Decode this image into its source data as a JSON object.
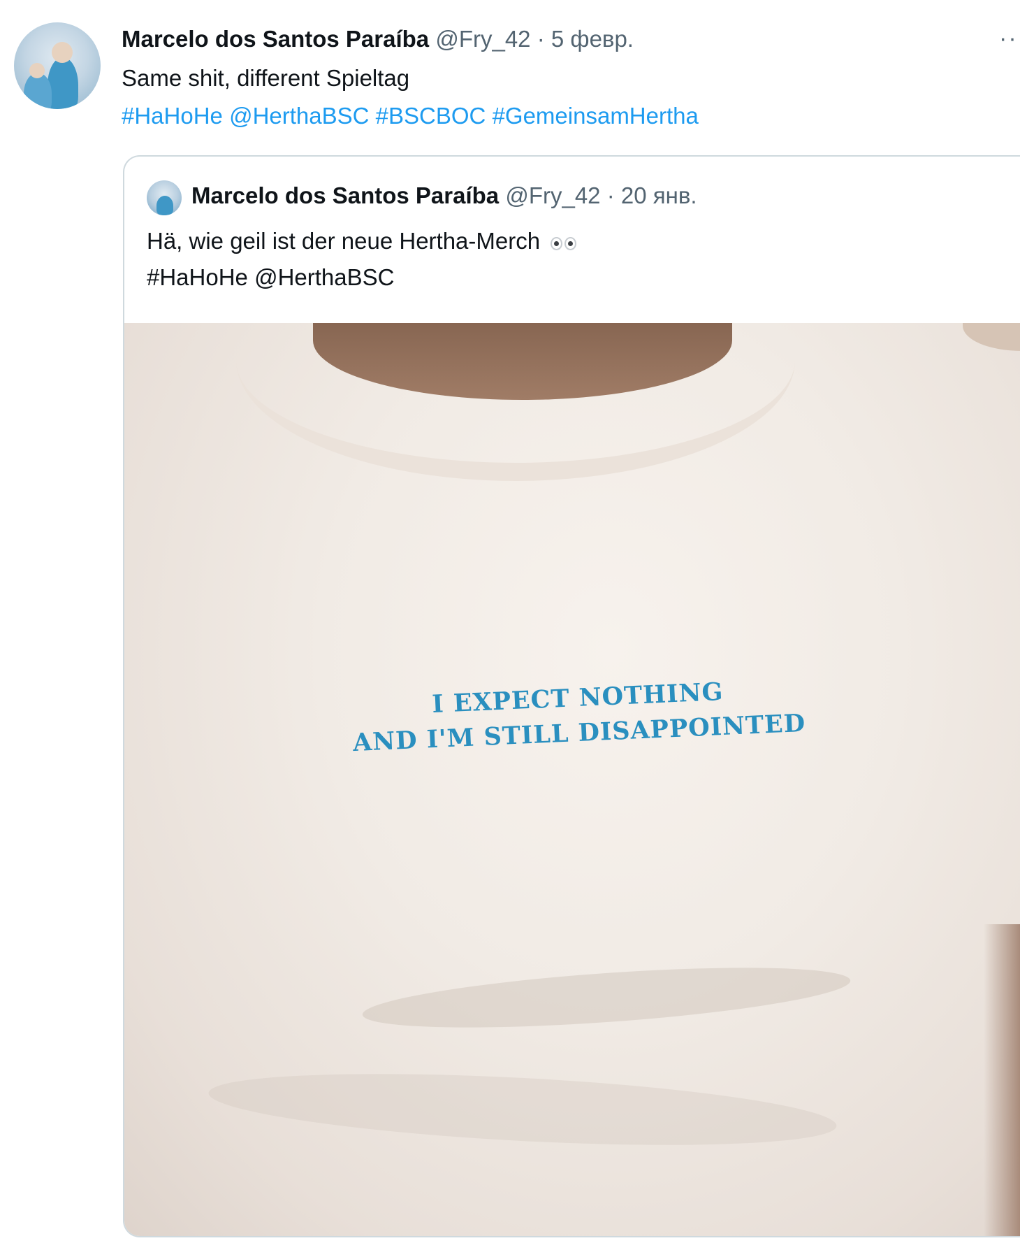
{
  "tweet": {
    "author_name": "Marcelo dos Santos Paraíba",
    "handle": "@Fry_42",
    "separator": "·",
    "date": "5 февр.",
    "more_icon": "···",
    "text": "Same shit, different Spieltag",
    "tags": [
      "#HaHoHe",
      "@HerthaBSC",
      "#BSCBOC",
      "#GemeinsamHertha"
    ]
  },
  "quoted_tweet": {
    "author_name": "Marcelo dos Santos Paraíba",
    "handle": "@Fry_42",
    "separator": "·",
    "date": "20 янв.",
    "text_line1": "Hä, wie geil ist der neue Hertha-Merch",
    "emoji": "eyes",
    "text_line2": "#HaHoHe @HerthaBSC",
    "media": {
      "shirt_text_line1": "I EXPECT NOTHING",
      "shirt_text_line2": "AND I'M STILL DISAPPOINTED"
    }
  },
  "colors": {
    "link": "#1d9bf0",
    "text": "#0f1419",
    "secondary": "#536471",
    "border": "#cfd9de",
    "shirt_print": "#2a8fbf"
  }
}
